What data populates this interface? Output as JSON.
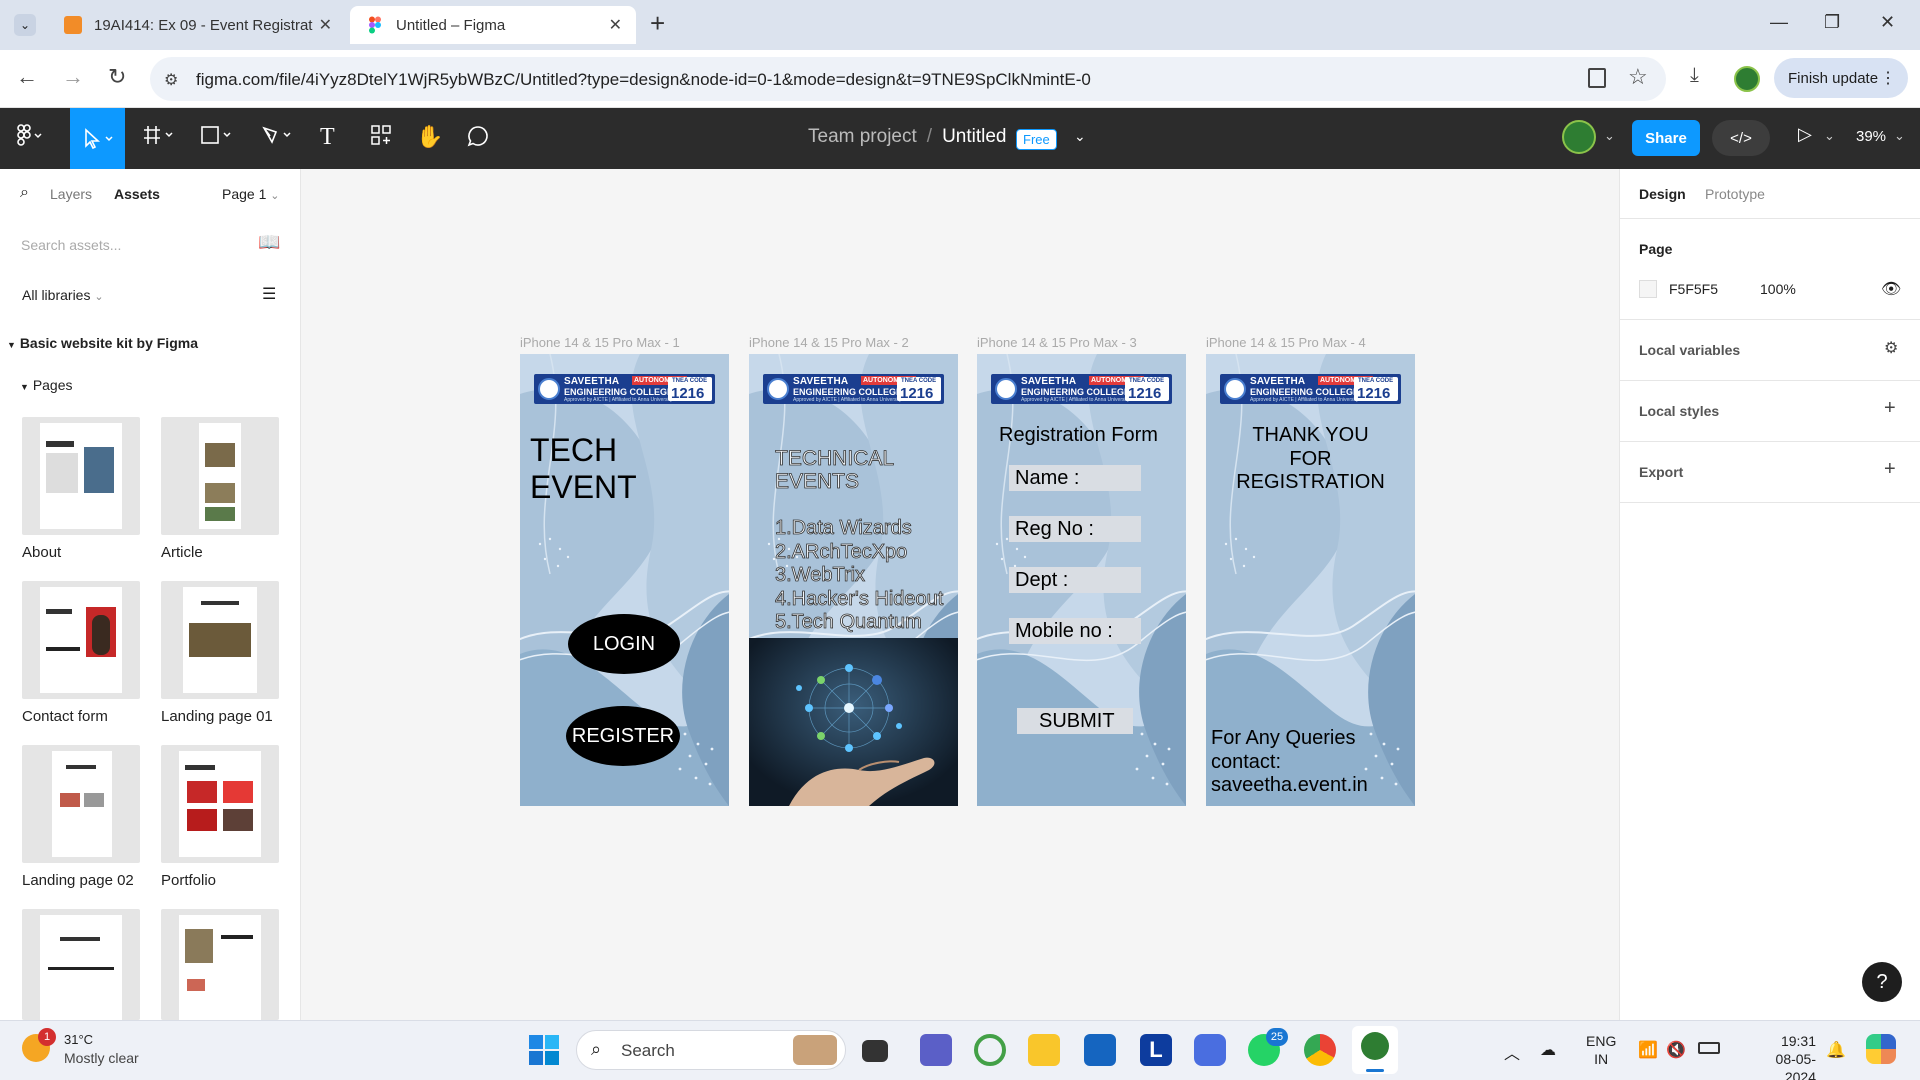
{
  "browser": {
    "tabs": [
      {
        "title": "19AI414: Ex 09 - Event Registrat",
        "active": false
      },
      {
        "title": "Untitled – Figma",
        "active": true
      }
    ],
    "new_tab": "+",
    "url": "figma.com/file/4iYyz8DtelY1WjR5ybWBzC/Untitled?type=design&node-id=0-1&mode=design&t=9TNE9SpClkNmintE-0",
    "finish_update": "Finish update"
  },
  "figma": {
    "team": "Team project",
    "separator": "/",
    "file_title": "Untitled",
    "plan_badge": "Free",
    "share_label": "Share",
    "zoom": "39%"
  },
  "left_panel": {
    "tabs": [
      "Layers",
      "Assets"
    ],
    "active_tab": "Assets",
    "page_selector": "Page 1",
    "search_placeholder": "Search assets...",
    "library_filter": "All libraries",
    "library_name": "Basic website kit by Figma",
    "pages_label": "Pages",
    "pages": [
      {
        "label": "About"
      },
      {
        "label": "Article"
      },
      {
        "label": "Contact form"
      },
      {
        "label": "Landing page 01"
      },
      {
        "label": "Landing page 02"
      },
      {
        "label": "Portfolio"
      },
      {
        "label": ""
      },
      {
        "label": ""
      }
    ]
  },
  "canvas": {
    "frames": [
      {
        "label": "iPhone 14 & 15 Pro Max - 1"
      },
      {
        "label": "iPhone 14 & 15 Pro Max - 2"
      },
      {
        "label": "iPhone 14 & 15 Pro Max - 3"
      },
      {
        "label": "iPhone 14 & 15 Pro Max - 4"
      }
    ],
    "logo": {
      "line1": "SAVEETHA",
      "autonomous": "AUTONOMOUS",
      "line2": "ENGINEERING COLLEGE",
      "line3": "Approved by AICTE | Affiliated to Anna University",
      "code_label": "TNEA CODE",
      "code": "1216"
    },
    "frame1": {
      "heading": "TECH EVENT",
      "login": "LOGIN",
      "register": "REGISTER"
    },
    "frame2": {
      "heading_line1": "TECHNICAL",
      "heading_line2": "EVENTS",
      "events": [
        "1.Data Wizards",
        "2.ARchTecXpo",
        "3.WebTrix",
        "4.Hacker's Hideout",
        "5.Tech Quantum"
      ]
    },
    "frame3": {
      "title": "Registration Form",
      "fields": [
        "Name :",
        "Reg No :",
        "Dept :",
        "Mobile no :"
      ],
      "submit": "SUBMIT"
    },
    "frame4": {
      "line1": "THANK YOU",
      "line2": "FOR",
      "line3": "REGISTRATION",
      "q1": "For Any Queries",
      "q2": "contact:",
      "q3": "saveetha.event.in"
    }
  },
  "right_panel": {
    "tabs": [
      "Design",
      "Prototype"
    ],
    "active_tab": "Design",
    "page_heading": "Page",
    "page_color": "F5F5F5",
    "page_opacity": "100%",
    "sections": [
      "Local variables",
      "Local styles",
      "Export"
    ]
  },
  "taskbar": {
    "weather_temp": "31°C",
    "weather_desc": "Mostly clear",
    "weather_badge": "1",
    "search": "Search",
    "whatsapp_badge": "25",
    "lang1": "ENG",
    "lang2": "IN",
    "time": "19:31",
    "date": "08-05-2024"
  },
  "colors": {
    "figma_blue": "#0d99ff",
    "toolbar_dark": "#2c2c2c",
    "canvas_bg": "#f5f5f5",
    "frame_blue": "#b9cde0"
  }
}
